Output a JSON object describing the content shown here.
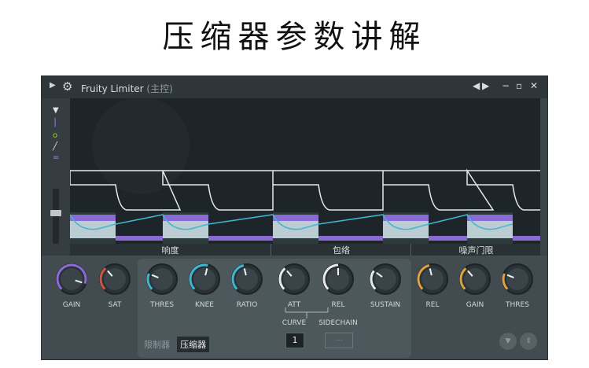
{
  "headline": "压缩器参数讲解",
  "window": {
    "title": "Fruity Limiter",
    "subtitle": "(主控)",
    "menu_icon": "triangle-right-icon",
    "gear_icon": "gear-icon"
  },
  "bands": [
    "响度",
    "包络",
    "噪声门限"
  ],
  "loudness": {
    "gain_label": "GAIN",
    "sat_label": "SAT",
    "gain_value": 0.9,
    "sat_value": 0.35
  },
  "compressor": {
    "thres_label": "THRES",
    "knee_label": "KNEE",
    "ratio_label": "RATIO",
    "thres_value": 0.25,
    "knee_value": 0.55,
    "ratio_value": 0.45
  },
  "envelope": {
    "att_label": "ATT",
    "rel_label": "REL",
    "sustain_label": "SUSTAIN",
    "att_value": 0.35,
    "rel_value": 0.5,
    "sustain_value": 0.3,
    "curve_label": "CURVE",
    "curve_value": "1",
    "sidechain_label": "SIDECHAIN",
    "sidechain_value": "---"
  },
  "gate": {
    "rel_label": "REL",
    "gain_label": "GAIN",
    "thres_label": "THRES",
    "rel_value": 0.45,
    "gain_value": 0.35,
    "thres_value": 0.25
  },
  "tabs": [
    "限制器",
    "压缩器"
  ],
  "active_tab": "压缩器",
  "colors": {
    "purple": "#8a6bd6",
    "red": "#d2533f",
    "cyan": "#3fb7d2",
    "white": "#e6eaec",
    "orange": "#e0a23a"
  }
}
